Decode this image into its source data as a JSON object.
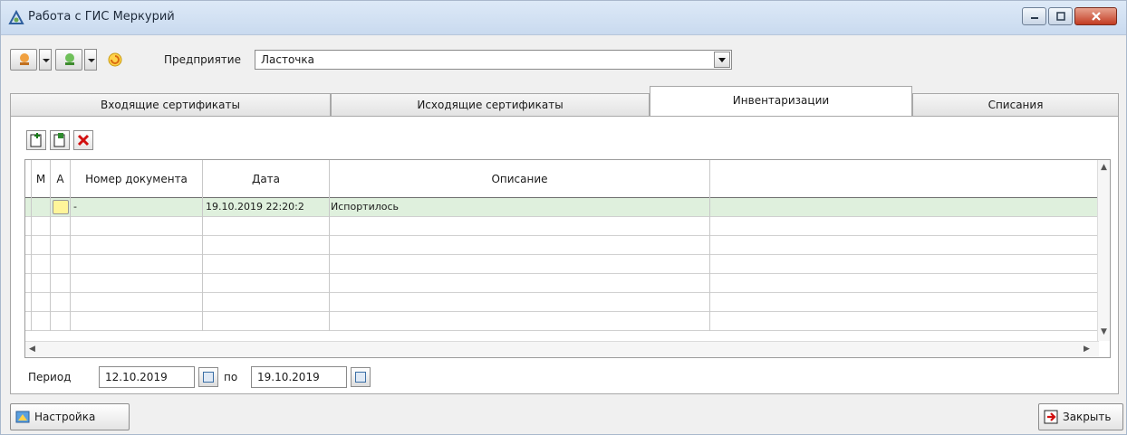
{
  "window": {
    "title": "Работа с ГИС Меркурий",
    "icon": "triangle-logo-icon"
  },
  "window_controls": {
    "minimize_icon": "minimize-icon",
    "maximize_icon": "maximize-icon",
    "close_icon": "close-icon"
  },
  "toolbar": {
    "buttons": [
      {
        "icon": "download-orange-icon"
      },
      {
        "icon": "download-green-icon"
      },
      {
        "icon": "refresh-icon"
      }
    ],
    "enterprise_label": "Предприятие",
    "enterprise_value": "Ласточка"
  },
  "tabs": [
    {
      "label": "Входящие сертификаты",
      "active": false
    },
    {
      "label": "Исходящие сертификаты",
      "active": false
    },
    {
      "label": "Инвентаризации",
      "active": true
    },
    {
      "label": "Списания",
      "active": false
    }
  ],
  "actions": {
    "add_icon": "add-document-icon",
    "edit_icon": "edit-document-icon",
    "delete_icon": "delete-icon"
  },
  "grid": {
    "columns": [
      "М",
      "А",
      "Номер документа",
      "Дата",
      "Описание"
    ],
    "rows": [
      {
        "m": "",
        "a_status": "yellow",
        "number": "-",
        "date": "19.10.2019 22:20:2",
        "description": "Испортилось"
      }
    ]
  },
  "period": {
    "label": "Период",
    "from": "12.10.2019",
    "to_label": "по",
    "to": "19.10.2019"
  },
  "buttons": {
    "settings": "Настройка",
    "close": "Закрыть"
  },
  "colors": {
    "selected_row": "#dff0dd",
    "status_yellow": "#fff59a",
    "close_accent": "#c23b22"
  }
}
